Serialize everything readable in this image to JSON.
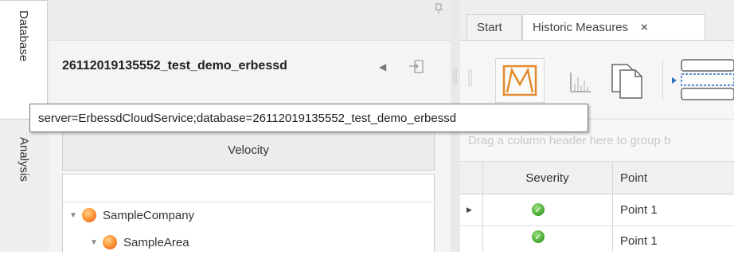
{
  "side_tabs": [
    "Database",
    "Analysis"
  ],
  "database_panel": {
    "title": "26112019135552_test_demo_erbessd",
    "pin_icon": "pin-icon",
    "collapse_icon": "chevron-left-icon",
    "expand_icon": "expand-panel-icon"
  },
  "tooltip": {
    "text": "server=ErbessdCloudService;database=26112019135552_test_demo_erbessd"
  },
  "velocity": {
    "header": "Velocity"
  },
  "tree": {
    "items": [
      {
        "label": "SampleCompany",
        "icon": "orange-orb-icon"
      },
      {
        "label": "SampleArea",
        "icon": "orange-orb-icon"
      }
    ]
  },
  "tabs": [
    {
      "label": "Start"
    },
    {
      "label": "Historic Measures",
      "close": "×"
    }
  ],
  "ribbon": {
    "buttons": [
      "measure-chart-icon",
      "spectrum-icon",
      "copy-pages-icon",
      "layout-icon"
    ]
  },
  "group_panel": {
    "text": "Drag a column header here to group b"
  },
  "grid": {
    "columns": [
      "Severity",
      "Point"
    ],
    "rows": [
      {
        "severity": "ok",
        "point": "Point 1",
        "current": true
      },
      {
        "severity": "ok",
        "point": "Point 1",
        "current": false
      }
    ]
  },
  "colors": {
    "accent_orange": "#f39a3c",
    "ok_green": "#4cae38"
  }
}
